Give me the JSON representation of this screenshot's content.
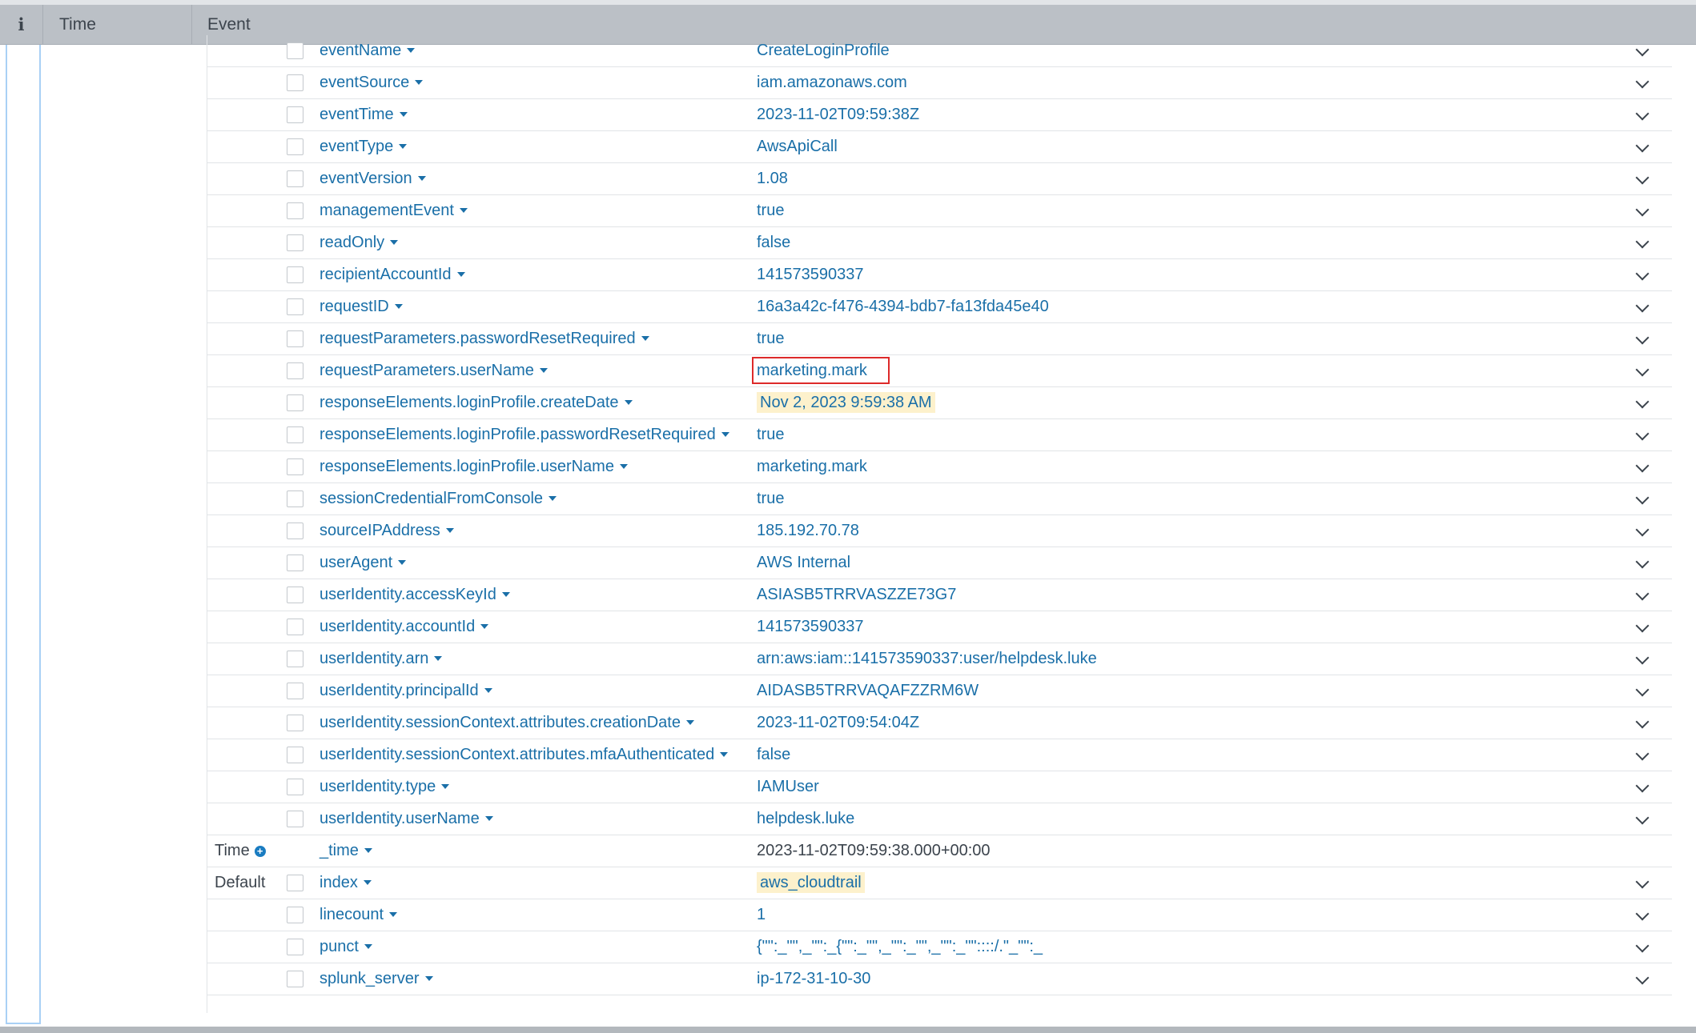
{
  "header": {
    "info_label": "i",
    "time_label": "Time",
    "event_label": "Event"
  },
  "rows": [
    {
      "field": "eventName",
      "value": "CreateLoginProfile"
    },
    {
      "field": "eventSource",
      "value": "iam.amazonaws.com"
    },
    {
      "field": "eventTime",
      "value": "2023-11-02T09:59:38Z"
    },
    {
      "field": "eventType",
      "value": "AwsApiCall"
    },
    {
      "field": "eventVersion",
      "value": "1.08"
    },
    {
      "field": "managementEvent",
      "value": "true"
    },
    {
      "field": "readOnly",
      "value": "false"
    },
    {
      "field": "recipientAccountId",
      "value": "141573590337"
    },
    {
      "field": "requestID",
      "value": "16a3a42c-f476-4394-bdb7-fa13fda45e40"
    },
    {
      "field": "requestParameters.passwordResetRequired",
      "value": "true"
    },
    {
      "field": "requestParameters.userName",
      "value": "marketing.mark",
      "boxed": true
    },
    {
      "field": "responseElements.loginProfile.createDate",
      "value": "Nov 2, 2023 9:59:38 AM",
      "highlight": true
    },
    {
      "field": "responseElements.loginProfile.passwordResetRequired",
      "value": "true"
    },
    {
      "field": "responseElements.loginProfile.userName",
      "value": "marketing.mark"
    },
    {
      "field": "sessionCredentialFromConsole",
      "value": "true"
    },
    {
      "field": "sourceIPAddress",
      "value": "185.192.70.78"
    },
    {
      "field": "userAgent",
      "value": "AWS Internal"
    },
    {
      "field": "userIdentity.accessKeyId",
      "value": "ASIASB5TRRVASZZE73G7"
    },
    {
      "field": "userIdentity.accountId",
      "value": "141573590337"
    },
    {
      "field": "userIdentity.arn",
      "value": "arn:aws:iam::141573590337:user/helpdesk.luke"
    },
    {
      "field": "userIdentity.principalId",
      "value": "AIDASB5TRRVAQAFZZRM6W"
    },
    {
      "field": "userIdentity.sessionContext.attributes.creationDate",
      "value": "2023-11-02T09:54:04Z"
    },
    {
      "field": "userIdentity.sessionContext.attributes.mfaAuthenticated",
      "value": "false"
    },
    {
      "field": "userIdentity.type",
      "value": "IAMUser"
    },
    {
      "field": "userIdentity.userName",
      "value": "helpdesk.luke"
    },
    {
      "group": "Time",
      "group_icon": "plus-circle-icon",
      "field": "_time",
      "value": "2023-11-02T09:59:38.000+00:00",
      "no_checkbox": true,
      "no_chevron": true,
      "plain": true
    },
    {
      "group": "Default",
      "field": "index",
      "value": "aws_cloudtrail",
      "highlight": true
    },
    {
      "field": "linecount",
      "value": "1"
    },
    {
      "field": "punct",
      "value": "{\"\":_\"\",_\"\":_{\"\":_\"\",_\"\":_\"\",_\"\":_\"\"::::/.\"_\"\":_"
    },
    {
      "field": "splunk_server",
      "value": "ip-172-31-10-30"
    }
  ]
}
